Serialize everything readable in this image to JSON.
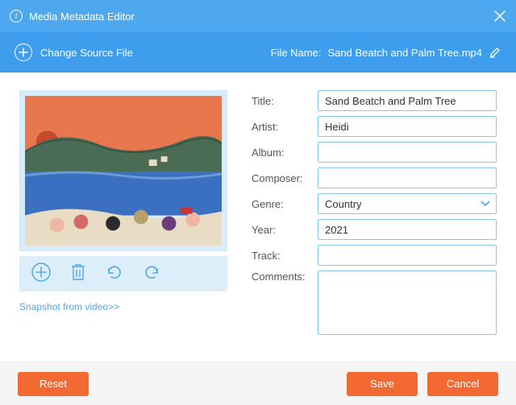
{
  "window": {
    "title": "Media Metadata Editor"
  },
  "subbar": {
    "change_source": "Change Source File",
    "filename_label": "File Name:",
    "filename": "Sand Beatch and Palm Tree.mp4"
  },
  "thumb": {
    "snapshot_link": "Snapshot from video>>"
  },
  "icons": {
    "info": "info-icon",
    "close": "close-icon",
    "plus": "plus-icon",
    "edit": "edit-icon",
    "add_thumb": "plus-icon",
    "delete": "trash-icon",
    "undo": "undo-icon",
    "redo": "redo-icon"
  },
  "fields": {
    "title": {
      "label": "Title:",
      "value": "Sand Beatch and Palm Tree"
    },
    "artist": {
      "label": "Artist:",
      "value": "Heidi"
    },
    "album": {
      "label": "Album:",
      "value": ""
    },
    "composer": {
      "label": "Composer:",
      "value": ""
    },
    "genre": {
      "label": "Genre:",
      "value": "Country"
    },
    "year": {
      "label": "Year:",
      "value": "2021"
    },
    "track": {
      "label": "Track:",
      "value": ""
    },
    "comments": {
      "label": "Comments:",
      "value": ""
    }
  },
  "footer": {
    "reset": "Reset",
    "save": "Save",
    "cancel": "Cancel"
  },
  "colors": {
    "accent": "#4da8f0",
    "accent_dark": "#3e9ded",
    "border": "#8bc5ef",
    "btn": "#f26a32"
  }
}
